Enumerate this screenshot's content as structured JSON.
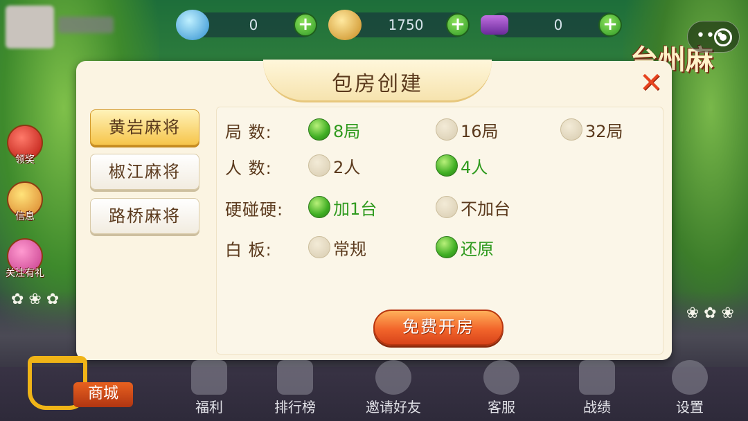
{
  "header": {
    "resources": [
      {
        "name": "diamond",
        "value": "0",
        "icon": "diamond-icon"
      },
      {
        "name": "gold",
        "value": "1750",
        "icon": "gold-ingot-icon"
      },
      {
        "name": "card",
        "value": "0",
        "icon": "room-card-icon"
      }
    ],
    "logo_text": "台州麻将"
  },
  "side_menu": [
    {
      "label": "领奖",
      "icon": "red-envelope-icon"
    },
    {
      "label": "信息",
      "icon": "mail-icon"
    },
    {
      "label": "关注有礼",
      "icon": "gift-icon"
    }
  ],
  "dialog": {
    "title": "包房创建",
    "tabs": [
      {
        "label": "黄岩麻将",
        "active": true
      },
      {
        "label": "椒江麻将",
        "active": false
      },
      {
        "label": "路桥麻将",
        "active": false
      }
    ],
    "rows": [
      {
        "label": "局  数:",
        "options": [
          {
            "label": "8局",
            "selected": true
          },
          {
            "label": "16局",
            "selected": false
          },
          {
            "label": "32局",
            "selected": false
          }
        ]
      },
      {
        "label": "人  数:",
        "options": [
          {
            "label": "2人",
            "selected": false
          },
          {
            "label": "4人",
            "selected": true
          }
        ]
      },
      {
        "label": "硬碰硬:",
        "options": [
          {
            "label": "加1台",
            "selected": true
          },
          {
            "label": "不加台",
            "selected": false
          }
        ]
      },
      {
        "label": "白  板:",
        "options": [
          {
            "label": "常规",
            "selected": false
          },
          {
            "label": "还原",
            "selected": true
          }
        ]
      }
    ],
    "create_button": "免费开房"
  },
  "bottom_nav": {
    "shop": "商城",
    "items": [
      {
        "label": "福利",
        "icon": "gift-box-icon"
      },
      {
        "label": "排行榜",
        "icon": "trophy-icon"
      },
      {
        "label": "邀请好友",
        "icon": "add-friend-icon"
      },
      {
        "label": "客服",
        "icon": "headset-icon"
      },
      {
        "label": "战绩",
        "icon": "crown-icon"
      },
      {
        "label": "设置",
        "icon": "gear-icon"
      }
    ]
  },
  "colors": {
    "accent_green": "#3fae23",
    "dialog_bg": "#fbf4e2",
    "button_orange": "#f2652b",
    "close_red": "#e7431e"
  }
}
